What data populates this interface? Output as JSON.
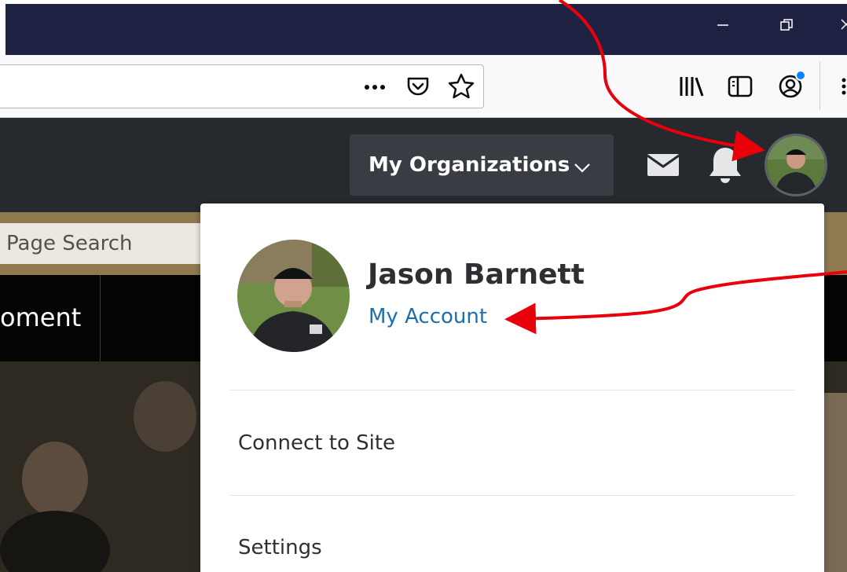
{
  "browser": {
    "window_controls": {
      "minimize": "minimize-icon",
      "restore": "restore-icon",
      "close": "close-icon"
    },
    "urlbar_icons": [
      "more-actions-icon",
      "pocket-icon",
      "bookmark-star-icon"
    ],
    "toolbar_icons": [
      "library-icon",
      "sidebar-icon",
      "account-icon",
      "menu-icon"
    ],
    "account_badge_color": "#0a84ff"
  },
  "site_header": {
    "org_button_label": "My Organizations",
    "icons": [
      "mail-icon",
      "bell-icon",
      "avatar"
    ]
  },
  "background": {
    "search_placeholder": "Page Search",
    "nav_partial_label": "oment"
  },
  "profile_menu": {
    "user_name": "Jason Barnett",
    "account_link": "My Account",
    "items": [
      {
        "label": "Connect to Site"
      },
      {
        "label": "Settings"
      }
    ]
  },
  "colors": {
    "title_bar": "#1f2143",
    "site_header": "#26292e",
    "link": "#1d6fb0",
    "annotation_arrow": "#e8000b"
  }
}
